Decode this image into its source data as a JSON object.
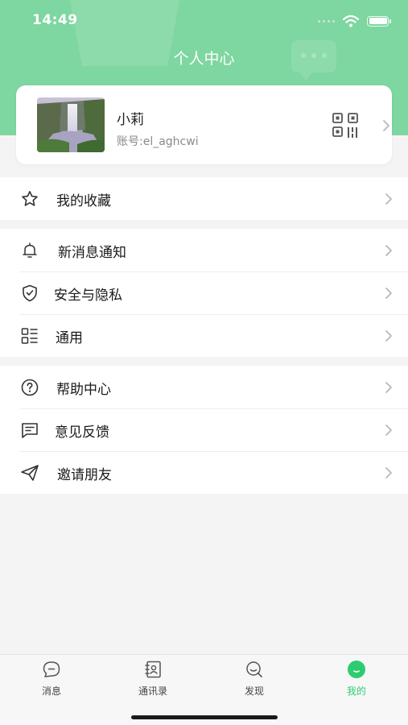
{
  "status_bar": {
    "time": "14:49"
  },
  "header": {
    "title": "个人中心"
  },
  "profile": {
    "name": "小莉",
    "account": "账号:el_aghcwi"
  },
  "menu": {
    "group1": [
      {
        "label": "我的收藏",
        "icon": "star-icon"
      }
    ],
    "group2": [
      {
        "label": "新消息通知",
        "icon": "bell-icon"
      },
      {
        "label": "安全与隐私",
        "icon": "shield-check-icon"
      },
      {
        "label": "通用",
        "icon": "list-icon"
      }
    ],
    "group3": [
      {
        "label": "帮助中心",
        "icon": "help-circle-icon"
      },
      {
        "label": "意见反馈",
        "icon": "feedback-icon"
      },
      {
        "label": "邀请朋友",
        "icon": "paper-plane-icon"
      }
    ]
  },
  "tabbar": {
    "tabs": [
      {
        "label": "消息",
        "icon": "chat-bubble-icon"
      },
      {
        "label": "通讯录",
        "icon": "contacts-book-icon"
      },
      {
        "label": "发现",
        "icon": "discover-icon"
      },
      {
        "label": "我的",
        "icon": "smile-icon",
        "active": true
      }
    ]
  },
  "colors": {
    "header_green": "#7ed6a0",
    "accent_green": "#2ecc71",
    "background": "#f4f4f4"
  }
}
